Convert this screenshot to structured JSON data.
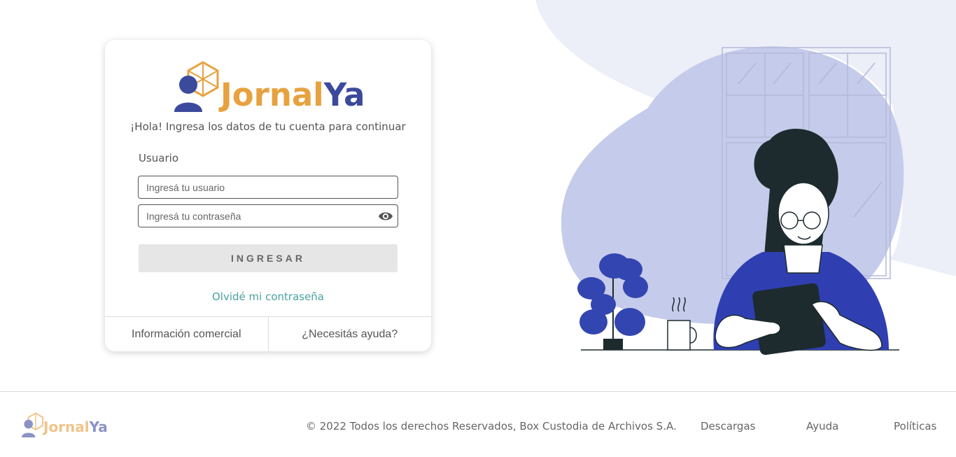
{
  "brand": {
    "part1": "Jornal",
    "part2": "Ya"
  },
  "login": {
    "greeting": "¡Hola! Ingresa los datos de tu cuenta para continuar",
    "user_label": "Usuario",
    "username_placeholder": "Ingresá tu usuario",
    "password_placeholder": "Ingresá tu contraseña",
    "submit_label": "INGRESAR",
    "forgot_label": "Olvidé mi contraseña",
    "footer_links": [
      "Información comercial",
      "¿Necesitás ayuda?"
    ]
  },
  "footer": {
    "copyright": "© 2022 Todos los derechos Reservados, Box Custodia de Archivos S.A.",
    "links": [
      "Descargas",
      "Ayuda",
      "Políticas"
    ]
  },
  "icons": {
    "password_toggle": "eye-icon",
    "logo_mark": "user-box-icon"
  },
  "colors": {
    "brand_orange": "#e7a23f",
    "brand_blue": "#3b4a9c",
    "link_teal": "#4aa3a0",
    "blob_light": "#eceef8",
    "blob_mid": "#c5cbea"
  }
}
